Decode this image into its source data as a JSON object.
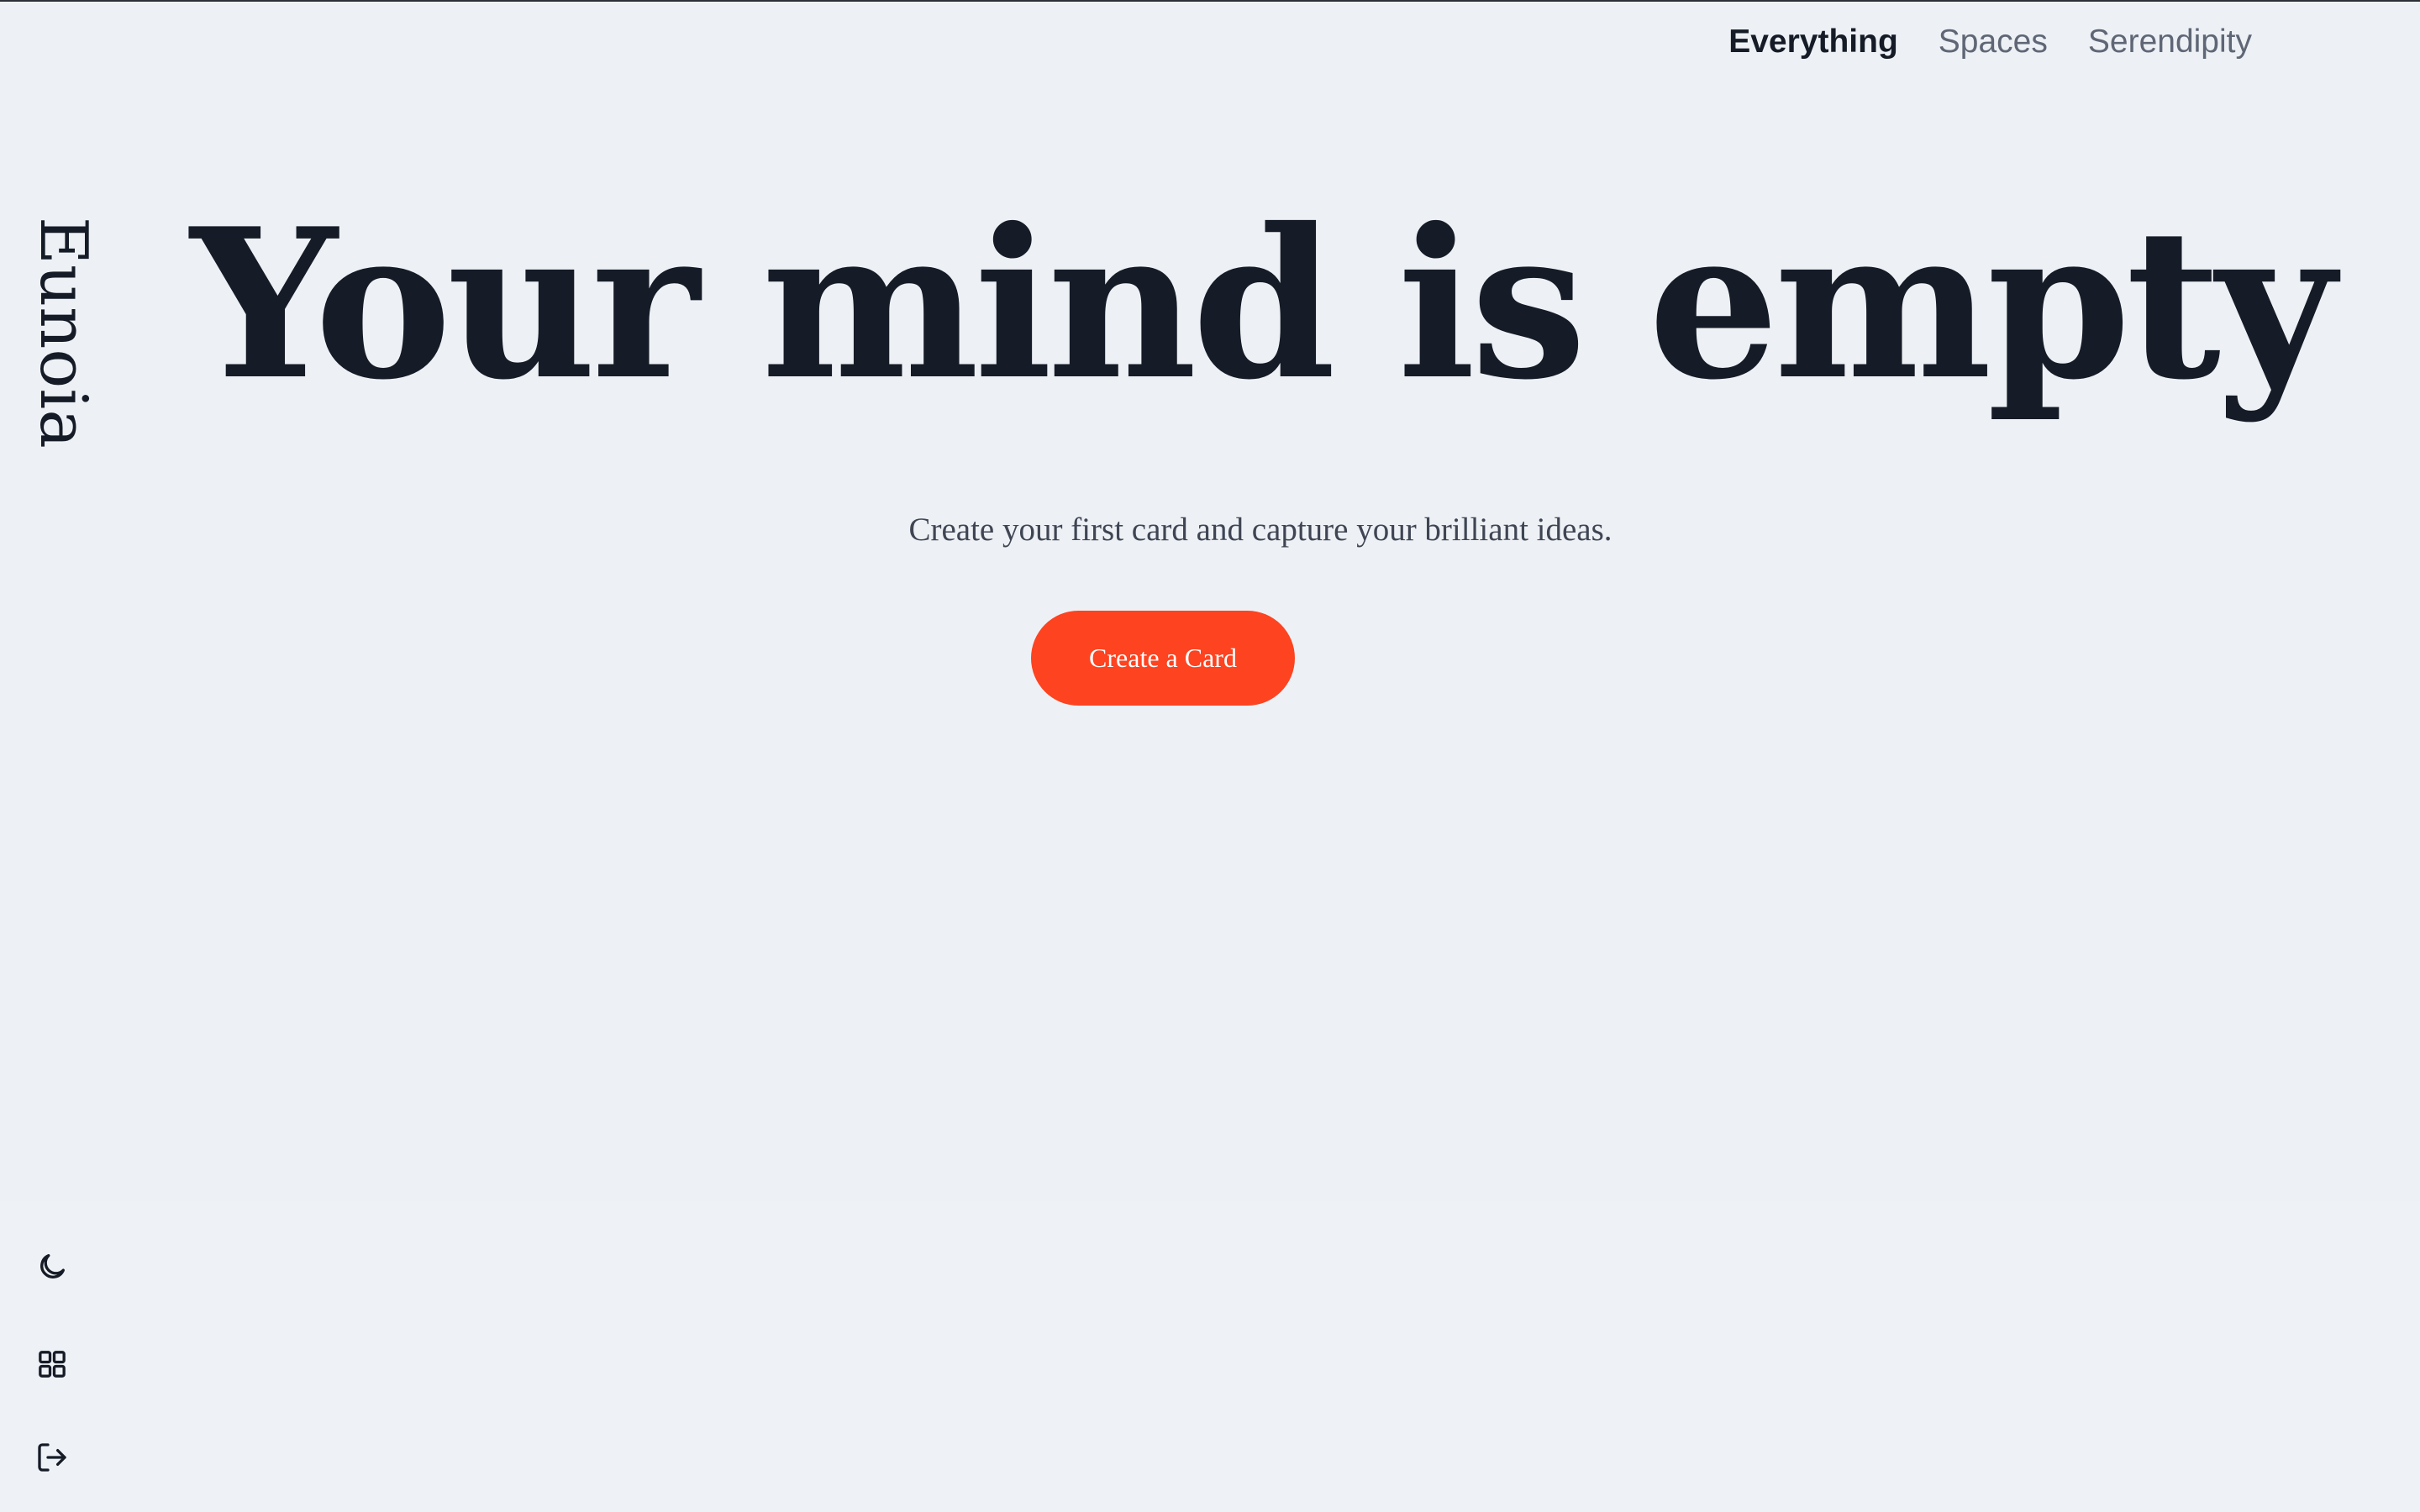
{
  "brand": {
    "name": "Eunoia"
  },
  "nav": {
    "items": [
      {
        "label": "Everything",
        "active": true
      },
      {
        "label": "Spaces",
        "active": false
      },
      {
        "label": "Serendipity",
        "active": false
      }
    ]
  },
  "hero": {
    "title": "Your mind is empty",
    "subtitle": "Create your first card and capture your brilliant ideas.",
    "cta_label": "Create a Card"
  },
  "sidebar_icons": [
    {
      "icon": "moon-icon",
      "purpose": "theme toggle"
    },
    {
      "icon": "grid-icon",
      "purpose": "view switch"
    },
    {
      "icon": "logout-icon",
      "purpose": "sign out"
    }
  ],
  "colors": {
    "background": "#edf1f5",
    "text": "#161c27",
    "muted": "#5f6675",
    "accent": "#fd4320"
  }
}
